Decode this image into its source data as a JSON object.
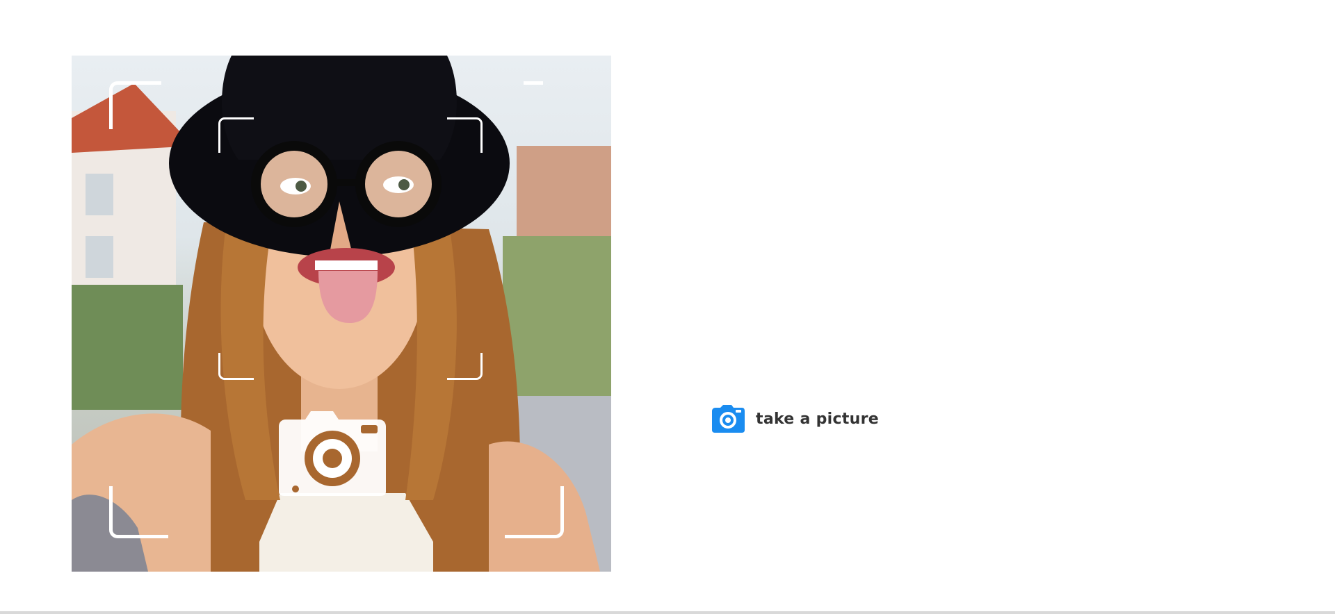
{
  "photo": {
    "icons": {
      "viewfinder": "viewfinder-frame",
      "camera": "camera-icon"
    }
  },
  "action": {
    "label": "take a picture",
    "icon": "camera-icon",
    "accent_color": "#1a8cf0"
  },
  "colors": {
    "label_text": "#333333",
    "background": "#ffffff",
    "divider": "#d9d9d9"
  }
}
